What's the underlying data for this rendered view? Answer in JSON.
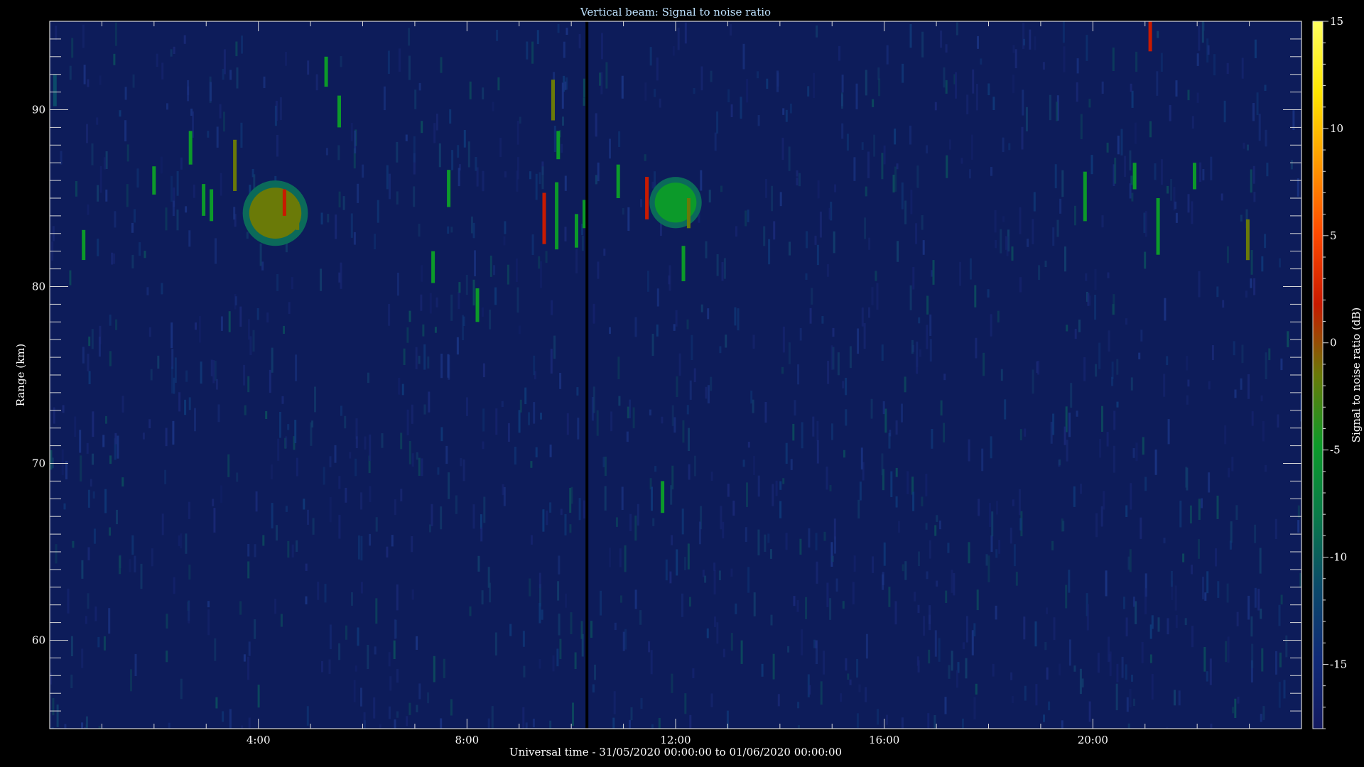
{
  "chart_data": {
    "type": "heatmap",
    "title": "Vertical beam: Signal to noise ratio",
    "xlabel": "Universal time - 31/05/2020 00:00:00 to 01/06/2020 00:00:00",
    "ylabel": "Range (km)",
    "colorbar_label": "Signal to noise ratio (dB)",
    "xlim": [
      0,
      24
    ],
    "ylim": [
      55,
      95
    ],
    "clim": [
      -18,
      15
    ],
    "x_ticks": [
      {
        "value": 4,
        "label": "4:00"
      },
      {
        "value": 8,
        "label": "8:00"
      },
      {
        "value": 12,
        "label": "12:00"
      },
      {
        "value": 16,
        "label": "16:00"
      },
      {
        "value": 20,
        "label": "20:00"
      }
    ],
    "y_ticks": [
      {
        "value": 60,
        "label": "60"
      },
      {
        "value": 70,
        "label": "70"
      },
      {
        "value": 80,
        "label": "80"
      },
      {
        "value": 90,
        "label": "90"
      }
    ],
    "colorbar_ticks": [
      {
        "value": 15,
        "label": "15"
      },
      {
        "value": 10,
        "label": "10"
      },
      {
        "value": 5,
        "label": "5"
      },
      {
        "value": 0,
        "label": "0"
      },
      {
        "value": -5,
        "label": "-5"
      },
      {
        "value": -10,
        "label": "-10"
      },
      {
        "value": -15,
        "label": "-15"
      }
    ],
    "colormap": [
      "#141a60",
      "#102a78",
      "#0b4a6a",
      "#0a7a4a",
      "#0c9a2a",
      "#6a7a08",
      "#c81a00",
      "#ff4a00",
      "#ff9a00",
      "#ffe600",
      "#ffff60"
    ],
    "background_color": "#0d1c5a",
    "data_gap_hour": 10.3,
    "echo_patches": [
      {
        "t_start": 3.7,
        "t_end": 4.95,
        "range_low": 82.3,
        "range_high": 86.0,
        "snr_db": -3
      },
      {
        "t_start": 11.5,
        "t_end": 12.5,
        "range_low": 83.3,
        "range_high": 86.2,
        "snr_db": -4
      }
    ],
    "echo_streaks": [
      {
        "t": 0.1,
        "range_low": 90.2,
        "range_high": 92.0,
        "snr_db": -10
      },
      {
        "t": 0.65,
        "range_low": 81.5,
        "range_high": 83.2,
        "snr_db": -5
      },
      {
        "t": 2.0,
        "range_low": 85.2,
        "range_high": 86.8,
        "snr_db": -5
      },
      {
        "t": 2.7,
        "range_low": 86.9,
        "range_high": 88.8,
        "snr_db": -5
      },
      {
        "t": 2.95,
        "range_low": 84.0,
        "range_high": 85.8,
        "snr_db": -5
      },
      {
        "t": 3.1,
        "range_low": 83.7,
        "range_high": 85.5,
        "snr_db": -5
      },
      {
        "t": 3.55,
        "range_low": 85.4,
        "range_high": 88.3,
        "snr_db": 0
      },
      {
        "t": 4.5,
        "range_low": 84.0,
        "range_high": 85.5,
        "snr_db": 1
      },
      {
        "t": 4.75,
        "range_low": 83.2,
        "range_high": 84.8,
        "snr_db": 0
      },
      {
        "t": 5.3,
        "range_low": 91.3,
        "range_high": 93.0,
        "snr_db": -5
      },
      {
        "t": 5.55,
        "range_low": 89.0,
        "range_high": 90.8,
        "snr_db": -5
      },
      {
        "t": 7.35,
        "range_low": 80.2,
        "range_high": 82.0,
        "snr_db": -5
      },
      {
        "t": 7.65,
        "range_low": 84.5,
        "range_high": 86.6,
        "snr_db": -5
      },
      {
        "t": 8.2,
        "range_low": 78.0,
        "range_high": 79.9,
        "snr_db": -5
      },
      {
        "t": 9.48,
        "range_low": 82.4,
        "range_high": 85.3,
        "snr_db": 1
      },
      {
        "t": 9.65,
        "range_low": 89.4,
        "range_high": 91.7,
        "snr_db": -2
      },
      {
        "t": 9.72,
        "range_low": 82.1,
        "range_high": 85.9,
        "snr_db": -5
      },
      {
        "t": 9.75,
        "range_low": 87.2,
        "range_high": 88.8,
        "snr_db": -5
      },
      {
        "t": 10.1,
        "range_low": 82.2,
        "range_high": 84.1,
        "snr_db": -5
      },
      {
        "t": 10.25,
        "range_low": 83.3,
        "range_high": 84.9,
        "snr_db": -6
      },
      {
        "t": 10.9,
        "range_low": 85.0,
        "range_high": 86.9,
        "snr_db": -5
      },
      {
        "t": 11.45,
        "range_low": 83.8,
        "range_high": 86.2,
        "snr_db": 1
      },
      {
        "t": 11.75,
        "range_low": 67.2,
        "range_high": 69.0,
        "snr_db": -5
      },
      {
        "t": 12.15,
        "range_low": 80.3,
        "range_high": 82.3,
        "snr_db": -5
      },
      {
        "t": 12.25,
        "range_low": 83.3,
        "range_high": 85.0,
        "snr_db": 0
      },
      {
        "t": 19.85,
        "range_low": 83.7,
        "range_high": 86.5,
        "snr_db": -5
      },
      {
        "t": 20.8,
        "range_low": 85.5,
        "range_high": 87.0,
        "snr_db": -5
      },
      {
        "t": 21.1,
        "range_low": 93.3,
        "range_high": 95.0,
        "snr_db": 3
      },
      {
        "t": 21.25,
        "range_low": 81.8,
        "range_high": 85.0,
        "snr_db": -5
      },
      {
        "t": 21.95,
        "range_low": 85.5,
        "range_high": 87.0,
        "snr_db": -6
      },
      {
        "t": 22.97,
        "range_low": 81.5,
        "range_high": 83.8,
        "snr_db": 0
      }
    ]
  }
}
